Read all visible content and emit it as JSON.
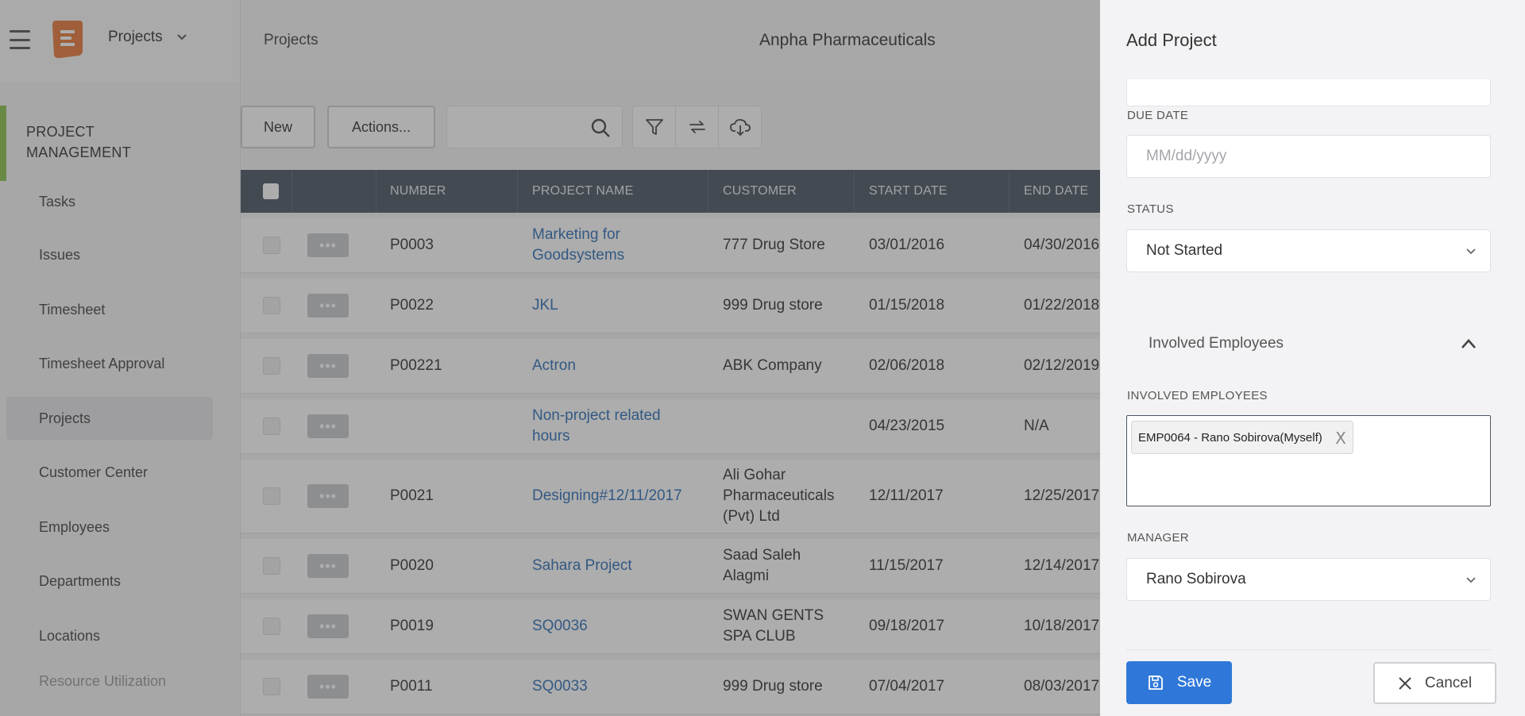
{
  "header": {
    "module": "Projects",
    "breadcrumb": "Projects",
    "company": "Anpha Pharmaceuticals"
  },
  "sidebar": {
    "section_title_line1": "PROJECT",
    "section_title_line2": "MANAGEMENT",
    "items": [
      {
        "label": "Tasks"
      },
      {
        "label": "Issues"
      },
      {
        "label": "Timesheet"
      },
      {
        "label": "Timesheet Approval"
      },
      {
        "label": "Projects",
        "active": true
      },
      {
        "label": "Customer Center"
      },
      {
        "label": "Employees"
      },
      {
        "label": "Departments"
      },
      {
        "label": "Locations"
      },
      {
        "label": "Resource Utilization"
      }
    ]
  },
  "toolbar": {
    "new_label": "New",
    "actions_label": "Actions...",
    "search_placeholder": ""
  },
  "table": {
    "columns": [
      "Number",
      "Project Name",
      "Customer",
      "Start Date",
      "End Date"
    ],
    "rows": [
      {
        "number": "P0003",
        "name": "Marketing for Goodsystems",
        "name_l1": "Marketing for",
        "name_l2": "Goodsystems",
        "customer": "777 Drug Store",
        "cust_l1": "777 Drug Store",
        "cust_l2": "",
        "cust_l3": "",
        "start": "03/01/2016",
        "end": "04/30/2016"
      },
      {
        "number": "P0022",
        "name": "JKL",
        "name_l1": "JKL",
        "name_l2": "",
        "customer": "999 Drug store",
        "cust_l1": "999 Drug store",
        "cust_l2": "",
        "cust_l3": "",
        "start": "01/15/2018",
        "end": "01/22/2018"
      },
      {
        "number": "P00221",
        "name": "Actron",
        "name_l1": "Actron",
        "name_l2": "",
        "customer": "ABK Company",
        "cust_l1": "ABK Company",
        "cust_l2": "",
        "cust_l3": "",
        "start": "02/06/2018",
        "end": "02/12/2019"
      },
      {
        "number": "",
        "name": "Non-project related hours",
        "name_l1": "Non-project related",
        "name_l2": "hours",
        "customer": "",
        "cust_l1": "",
        "cust_l2": "",
        "cust_l3": "",
        "start": "04/23/2015",
        "end": "N/A"
      },
      {
        "number": "P0021",
        "name": "Designing#12/11/2017",
        "name_l1": "Designing#12/11/2017",
        "name_l2": "",
        "customer": "Ali Gohar Pharmaceuticals (Pvt) Ltd",
        "cust_l1": "Ali Gohar",
        "cust_l2": "Pharmaceuticals",
        "cust_l3": "(Pvt) Ltd",
        "start": "12/11/2017",
        "end": "12/25/2017"
      },
      {
        "number": "P0020",
        "name": "Sahara Project",
        "name_l1": "Sahara Project",
        "name_l2": "",
        "customer": "Saad Saleh Alagmi",
        "cust_l1": "Saad Saleh",
        "cust_l2": "Alagmi",
        "cust_l3": "",
        "start": "11/15/2017",
        "end": "12/14/2017"
      },
      {
        "number": "P0019",
        "name": "SQ0036",
        "name_l1": "SQ0036",
        "name_l2": "",
        "customer": "SWAN GENTS SPA CLUB",
        "cust_l1": "SWAN GENTS",
        "cust_l2": "SPA CLUB",
        "cust_l3": "",
        "start": "09/18/2017",
        "end": "10/18/2017"
      },
      {
        "number": "P0011",
        "name": "SQ0033",
        "name_l1": "SQ0033",
        "name_l2": "",
        "customer": "999 Drug store",
        "cust_l1": "999 Drug store",
        "cust_l2": "",
        "cust_l3": "",
        "start": "07/04/2017",
        "end": "08/03/2017"
      }
    ]
  },
  "drawer": {
    "title": "Add Project",
    "due_date_label": "DUE DATE",
    "due_date_placeholder": "MM/dd/yyyy",
    "status_label": "STATUS",
    "status_value": "Not Started",
    "section_title": "Involved Employees",
    "involved_label": "INVOLVED EMPLOYEES",
    "involved_tags": [
      "EMP0064 - Rano Sobirova(Myself)"
    ],
    "tag_remove": "X",
    "manager_label": "MANAGER",
    "manager_value": "Rano Sobirova",
    "save_label": "Save",
    "cancel_label": "Cancel"
  },
  "colors": {
    "accent_green": "#8bc34a",
    "header_dark": "#4a5563",
    "link_blue": "#2e6fb7",
    "save_blue": "#2f78d9",
    "logo_orange": "#e8793a"
  },
  "icons": [
    "menu-icon",
    "app-logo",
    "chevron-down-icon",
    "search-icon",
    "filter-icon",
    "refresh-icon",
    "cloud-download-icon",
    "more-icon",
    "chevron-up-icon",
    "close-icon",
    "save-icon"
  ]
}
